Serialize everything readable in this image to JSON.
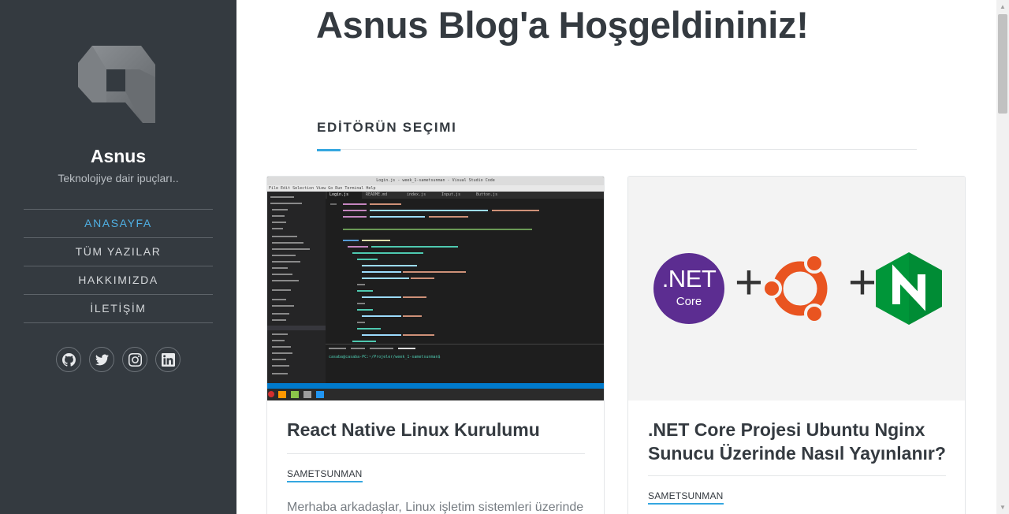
{
  "sidebar": {
    "site_title": "Asnus",
    "tagline": "Teknolojiye dair ipuçları..",
    "nav": [
      {
        "label": "ANASAYFA",
        "active": true
      },
      {
        "label": "TÜM YAZILAR",
        "active": false
      },
      {
        "label": "HAKKIMIZDA",
        "active": false
      },
      {
        "label": "İLETİŞİM",
        "active": false
      }
    ],
    "social_icons": [
      "github-icon",
      "twitter-icon",
      "instagram-icon",
      "linkedin-icon"
    ]
  },
  "main": {
    "page_title": "Asnus Blog'a Hoşgeldininiz!",
    "section_heading": "EDİTÖRÜN SEÇIMI",
    "posts": [
      {
        "title": "React Native Linux Kurulumu",
        "author": "SAMETSUNMAN",
        "excerpt": "Merhaba arkadaşlar, Linux işletim sistemleri üzerinde",
        "image": {
          "window_title": "Login.js - week_1-sametsunman - Visual Studio Code",
          "menu": "File  Edit  Selection  View  Go  Run  Terminal  Help",
          "tabs": [
            "Login.js",
            "README.md",
            "index.js",
            "Input.js",
            "Button.js"
          ],
          "terminal_line": "casaba@casaba-PC:~/Projeler/week_1-sametsunman$ "
        }
      },
      {
        "title": ".NET Core Projesi Ubuntu Nginx Sunucu Üzerinde Nasıl Yayınlanır?",
        "author": "SAMETSUNMAN",
        "image": {
          "net_label": ".NET",
          "core_label": "Core",
          "plus": "+"
        }
      }
    ]
  },
  "colors": {
    "sidebar_bg": "#343a40",
    "accent": "#35a7e0",
    "heading": "#343a40",
    "dotnet_purple": "#5c2d91",
    "ubuntu_orange": "#e95420",
    "nginx_green": "#009639"
  }
}
